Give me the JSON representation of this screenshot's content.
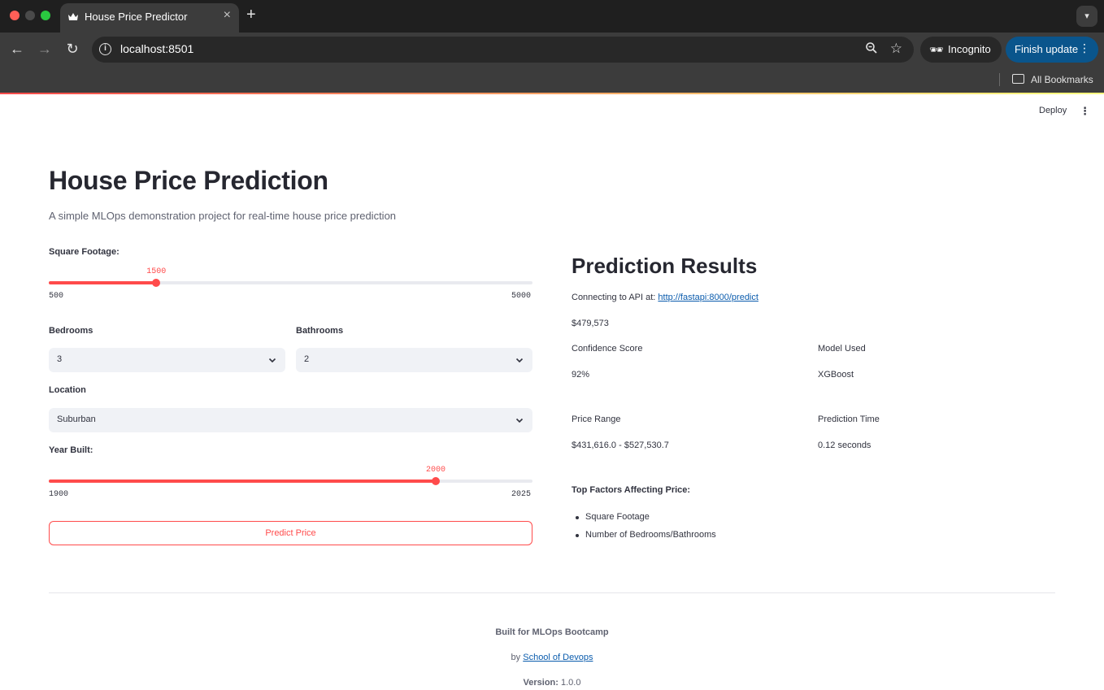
{
  "browser": {
    "tab_title": "House Price Predictor",
    "url": "localhost:8501",
    "incognito_label": "Incognito",
    "finish_update_label": "Finish update",
    "bookmarks_label": "All Bookmarks"
  },
  "app_header": {
    "deploy_label": "Deploy"
  },
  "page": {
    "title": "House Price Prediction",
    "subtitle": "A simple MLOps demonstration project for real-time house price prediction"
  },
  "form": {
    "square_footage": {
      "label": "Square Footage:",
      "value": "1500",
      "min": "500",
      "max": "5000",
      "fraction": 0.2222
    },
    "bedrooms": {
      "label": "Bedrooms",
      "value": "3"
    },
    "bathrooms": {
      "label": "Bathrooms",
      "value": "2"
    },
    "location": {
      "label": "Location",
      "value": "Suburban"
    },
    "year_built": {
      "label": "Year Built:",
      "value": "2000",
      "min": "1900",
      "max": "2025",
      "fraction": 0.8
    },
    "predict_label": "Predict Price"
  },
  "results": {
    "title": "Prediction Results",
    "api_prefix": "Connecting to API at: ",
    "api_url": "http://fastapi:8000/predict",
    "price": "$479,573",
    "confidence_label": "Confidence Score",
    "confidence_value": "92%",
    "model_label": "Model Used",
    "model_value": "XGBoost",
    "range_label": "Price Range",
    "range_value": "$431,616.0 - $527,530.7",
    "time_label": "Prediction Time",
    "time_value": "0.12 seconds",
    "factors_title": "Top Factors Affecting Price:",
    "factors": [
      "Square Footage",
      "Number of Bedrooms/Bathrooms"
    ]
  },
  "footer": {
    "built_for": "Built for MLOps Bootcamp",
    "by_prefix": "by ",
    "by_link": "School of Devops",
    "version_label": "Version:",
    "version_value": " 1.0.0"
  },
  "colors": {
    "accent": "#ff4b4b",
    "link": "#0b5cad",
    "update_button": "#0a558c"
  }
}
